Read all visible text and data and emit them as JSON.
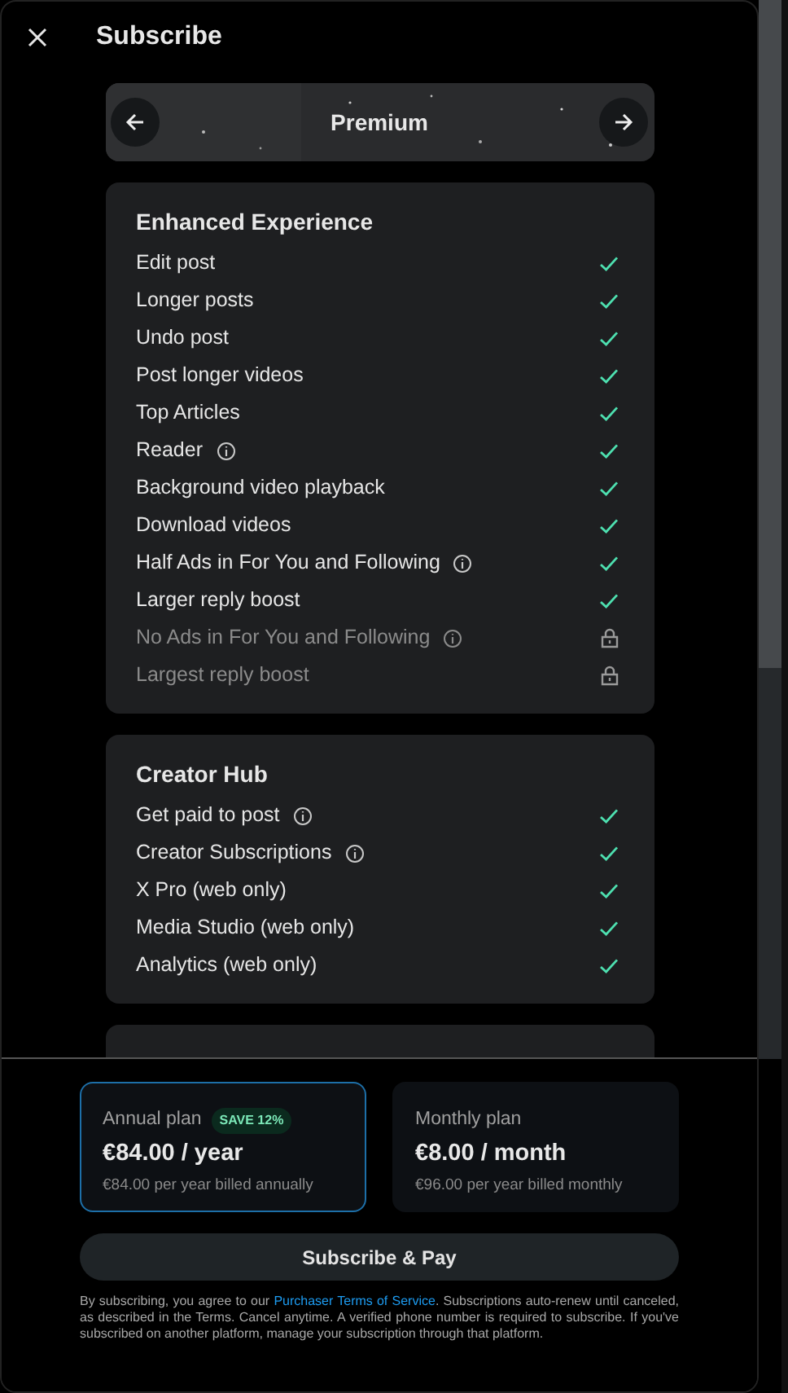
{
  "header": {
    "title": "Subscribe"
  },
  "tier": {
    "name": "Premium"
  },
  "sections": [
    {
      "title": "Enhanced Experience",
      "features": [
        {
          "label": "Edit post",
          "kind": "check",
          "info": false
        },
        {
          "label": "Longer posts",
          "kind": "check",
          "info": false
        },
        {
          "label": "Undo post",
          "kind": "check",
          "info": false
        },
        {
          "label": "Post longer videos",
          "kind": "check",
          "info": false
        },
        {
          "label": "Top Articles",
          "kind": "check",
          "info": false
        },
        {
          "label": "Reader",
          "kind": "check",
          "info": true
        },
        {
          "label": "Background video playback",
          "kind": "check",
          "info": false
        },
        {
          "label": "Download videos",
          "kind": "check",
          "info": false
        },
        {
          "label": "Half Ads in For You and Following",
          "kind": "check",
          "info": true
        },
        {
          "label": "Larger reply boost",
          "kind": "check",
          "info": false
        },
        {
          "label": "No Ads in For You and Following",
          "kind": "locked",
          "info": true
        },
        {
          "label": "Largest reply boost",
          "kind": "locked",
          "info": false
        }
      ]
    },
    {
      "title": "Creator Hub",
      "features": [
        {
          "label": "Get paid to post",
          "kind": "check",
          "info": true
        },
        {
          "label": "Creator Subscriptions",
          "kind": "check",
          "info": true
        },
        {
          "label": "X Pro (web only)",
          "kind": "check",
          "info": false
        },
        {
          "label": "Media Studio (web only)",
          "kind": "check",
          "info": false
        },
        {
          "label": "Analytics (web only)",
          "kind": "check",
          "info": false
        }
      ]
    }
  ],
  "plans": [
    {
      "name": "Annual plan",
      "badge": "SAVE 12%",
      "price": "€84.00 / year",
      "note": "€84.00 per year billed annually",
      "selected": true
    },
    {
      "name": "Monthly plan",
      "price": "€8.00 / month",
      "note": "€96.00 per year billed monthly",
      "selected": false
    }
  ],
  "subscribe_button": "Subscribe & Pay",
  "legal": {
    "before": "By subscribing, you agree to our ",
    "link": "Purchaser Terms of Service",
    "after": ". Subscriptions auto-renew until canceled, as described in the Terms. Cancel anytime. A verified phone number is required to subscribe. If you've subscribed on another platform, manage your subscription through that platform."
  }
}
